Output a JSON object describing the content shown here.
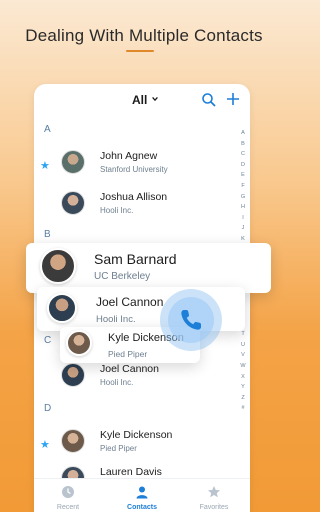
{
  "headline": "Dealing With Multiple Contacts",
  "topbar": {
    "filter_label": "All",
    "icons": [
      "chevron-down-icon",
      "search-icon",
      "plus-icon"
    ]
  },
  "sections": [
    "A",
    "B",
    "C",
    "D"
  ],
  "contacts": [
    {
      "name": "John Agnew",
      "org": "Stanford University",
      "favorite": true
    },
    {
      "name": "Joshua Allison",
      "org": "Hooli Inc.",
      "favorite": false
    },
    {
      "name": "Joel Cannon",
      "org": "Hooli Inc.",
      "favorite": false
    },
    {
      "name": "Kyle Dickenson",
      "org": "Pied Piper",
      "favorite": true
    },
    {
      "name": "Lauren Davis",
      "org": "",
      "favorite": false
    }
  ],
  "alphabet_index": [
    "A",
    "B",
    "C",
    "D",
    "E",
    "F",
    "G",
    "H",
    "I",
    "J",
    "K",
    "L",
    "M",
    "N",
    "O",
    "P",
    "Q",
    "R",
    "S",
    "T",
    "U",
    "V",
    "W",
    "X",
    "Y",
    "Z",
    "#"
  ],
  "floating_cards": [
    {
      "name": "Sam Barnard",
      "org": "UC Berkeley"
    },
    {
      "name": "Joel Cannon",
      "org": "Hooli Inc."
    },
    {
      "name": "Kyle Dickenson",
      "org": "Pied Piper"
    }
  ],
  "tabs": [
    {
      "label": "Recent",
      "icon": "clock-icon",
      "active": false
    },
    {
      "label": "Contacts",
      "icon": "person-icon",
      "active": true
    },
    {
      "label": "Favorites",
      "icon": "star-icon",
      "active": false
    }
  ],
  "colors": {
    "accent": "#1d7fd8",
    "star": "#2aa4f4",
    "underline": "#e0892b"
  }
}
